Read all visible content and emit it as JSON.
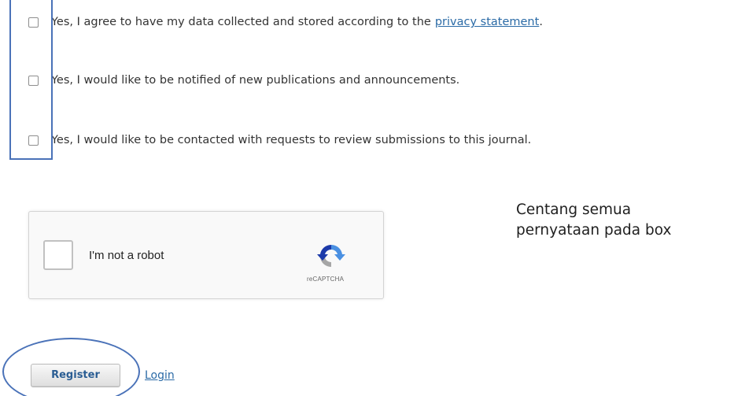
{
  "consents": [
    {
      "text": "Yes, I agree to have my data collected and stored according to the",
      "link": "privacy statement",
      "suffix": "."
    },
    {
      "text": "Yes, I would like to be notified of new publications and announcements."
    },
    {
      "text": "Yes, I would like to be contacted with requests to review submissions to this journal."
    }
  ],
  "recaptcha": {
    "label": "I'm not a robot",
    "brand": "reCAPTCHA",
    "icon": "recaptcha-icon"
  },
  "note": {
    "line1": "Centang semua",
    "line2": "pernyataan pada box"
  },
  "actions": {
    "register_label": "Register",
    "login_label": "Login"
  },
  "colors": {
    "annotation": "#4a72b8",
    "link": "#2a6aa6"
  }
}
